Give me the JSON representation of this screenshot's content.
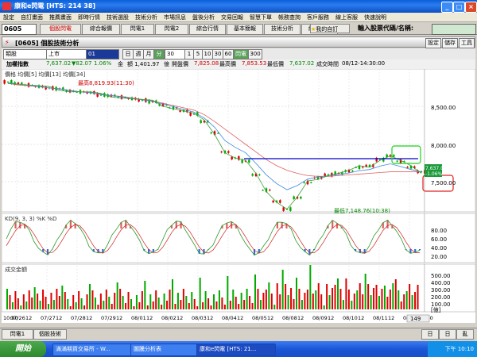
{
  "window": {
    "title": "康和e閃電 [HTS: 214 38]"
  },
  "menu": [
    "設定",
    "自訂畫面",
    "推薦畫面",
    "即時行情",
    "技術選股",
    "技術分析",
    "市場訊息",
    "盤後分析",
    "交易回報",
    "智慧下單",
    "帳務查詢",
    "客戶服務",
    "線上客服",
    "快速說明"
  ],
  "toolbar": {
    "code": "0605",
    "buttons": [
      "個股閃電",
      "綜合報價",
      "閃電1",
      "閃電2",
      "綜合行情",
      "基本簡報",
      "技術分析",
      "綜合新聞",
      "我的自訂"
    ],
    "input_label": "輸入股票代碼/名稱:"
  },
  "panel": {
    "title": "[0605] 個股技術分析",
    "right_buttons": [
      "設定",
      "儲存",
      "工具"
    ]
  },
  "controls": {
    "select1": "類股",
    "select2": "上市",
    "select3": "01",
    "periods": [
      "日",
      "週",
      "月",
      "分"
    ],
    "minutes": "30",
    "ranges": [
      "1",
      "5",
      "10",
      "30",
      "60",
      "閃電",
      "300"
    ]
  },
  "info": {
    "name": "加權指數",
    "price": "7,637.02",
    "change": "▼82.07",
    "pct": "1.06%",
    "amount_label": "金",
    "amount": "額 1,401.97",
    "u1": "億",
    "open_label": "開盤價",
    "open": "7,825.08",
    "high_label": "最高價",
    "high": "7,853.53",
    "low_label": "最低價",
    "low": "7,637.02",
    "time_label": "成交時間",
    "time": "08/12-14:30:00"
  },
  "chart": {
    "price_legend": "價格 均價[5] 均價[13] 均價[34]",
    "high_note": "最高8,819.93(11:30)",
    "low_note": "最低7,148.76(10:38)",
    "kd_legend": "KD(9, 3, 3) %K %D",
    "vol_legend": "成交金額",
    "price_axis": [
      "8,500.00",
      "8,000.00",
      "7,500.00"
    ],
    "kd_axis": [
      "80.00",
      "60.00",
      "40.00",
      "20.00"
    ],
    "vol_axis": [
      "500.00",
      "400.00",
      "300.00",
      "200.00",
      "100.00",
      "[億]"
    ],
    "last_price": "7,637.02",
    "last_pct": "-1.06%",
    "x_labels": [
      "10:00",
      "07/26",
      "12",
      "07/27",
      "12",
      "07/28",
      "12",
      "07/29",
      "12",
      "08/01",
      "12",
      "08/02",
      "12",
      "08/03",
      "12",
      "08/04",
      "12",
      "08/05",
      "12",
      "08/08",
      "12",
      "08/09",
      "12",
      "08/10",
      "12",
      "08/11",
      "12",
      "08/12",
      "13:30"
    ],
    "scroll_label": "149"
  },
  "bottom_tabs": [
    "閃電1",
    "個股技術"
  ],
  "bottom_right": [
    "日",
    "日",
    "亂"
  ],
  "taskbar": {
    "start": "開始",
    "tasks": [
      "滿滿期貨交易所 - W...",
      "圖騰分析表",
      "康和e閃電 [HTS: 21..."
    ],
    "clock": "下午 10:10"
  },
  "chart_data": {
    "type": "candlestick",
    "price_points": [
      8820,
      8800,
      8780,
      8760,
      8740,
      8730,
      8700,
      8690,
      8680,
      8650,
      8640,
      8620,
      8600,
      8580,
      8560,
      8520,
      8480,
      8440,
      8400,
      8300,
      8150,
      7900,
      7820,
      7780,
      7600,
      7400,
      7250,
      7150,
      7300,
      7500,
      7560,
      7600,
      7620,
      7650,
      7700,
      7720,
      7800,
      7850,
      7780,
      7700,
      7640
    ],
    "ma34": [
      8800,
      8780,
      8770,
      8760,
      8740,
      8730,
      8710,
      8690,
      8680,
      8660,
      8640,
      8630,
      8610,
      8590,
      8570,
      8540,
      8510,
      8480,
      8450,
      8390,
      8300,
      8200,
      8100,
      8000,
      7900,
      7800,
      7720,
      7660,
      7620,
      7590,
      7580,
      7580,
      7590,
      7600,
      7610,
      7620,
      7630,
      7640,
      7640,
      7640,
      7640
    ],
    "reference_line": 7820
  }
}
